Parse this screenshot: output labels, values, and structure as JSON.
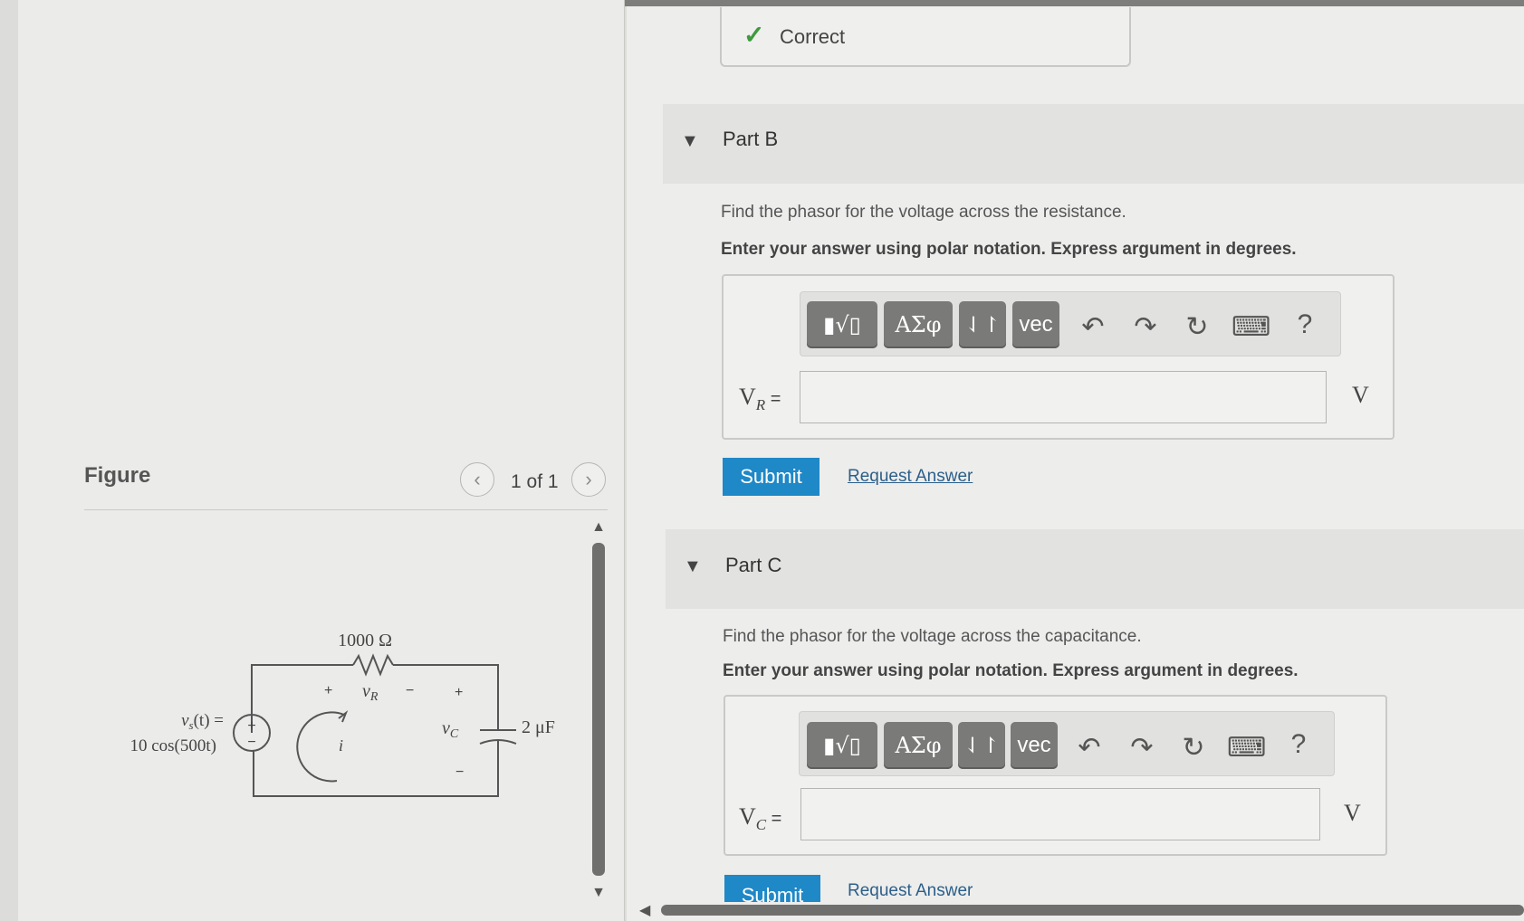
{
  "figure": {
    "title": "Figure",
    "pager": "1 of 1",
    "prev_icon": "chevron-left-icon",
    "next_icon": "chevron-right-icon",
    "circuit": {
      "resistor": "1000 Ω",
      "source_lhs": "v",
      "source_sub": "s",
      "source_arg": "(t) =",
      "source_expr": "10 cos(500t)",
      "plus": "+",
      "minus": "−",
      "vr": "v",
      "vr_sub": "R",
      "vc": "v",
      "vc_sub": "C",
      "current": "i",
      "capacitor": "2 μF"
    }
  },
  "status": {
    "icon": "check-icon",
    "text": "Correct"
  },
  "part_b": {
    "title": "Part B",
    "question": "Find the phasor for the voltage across the resistance.",
    "instruction": "Enter your answer using polar notation. Express argument in degrees.",
    "toolbar": {
      "templates": "▮√▯",
      "greek": "ΑΣφ",
      "arrows": "⇃↾",
      "vec": "vec",
      "undo": "↶",
      "redo": "↷",
      "reset": "↻",
      "keyboard": "⌨",
      "help": "?"
    },
    "var": "V",
    "var_sub": "R",
    "eq": " =",
    "value": "",
    "unit": "V",
    "submit": "Submit",
    "request": "Request Answer"
  },
  "part_c": {
    "title": "Part C",
    "question": "Find the phasor for the voltage across the capacitance.",
    "instruction": "Enter your answer using polar notation. Express argument in degrees.",
    "toolbar": {
      "templates": "▮√▯",
      "greek": "ΑΣφ",
      "arrows": "⇃↾",
      "vec": "vec",
      "undo": "↶",
      "redo": "↷",
      "reset": "↻",
      "keyboard": "⌨",
      "help": "?"
    },
    "var": "V",
    "var_sub": "C",
    "eq": " =",
    "value": "",
    "unit": "V",
    "submit": "Submit",
    "request": "Request Answer"
  }
}
